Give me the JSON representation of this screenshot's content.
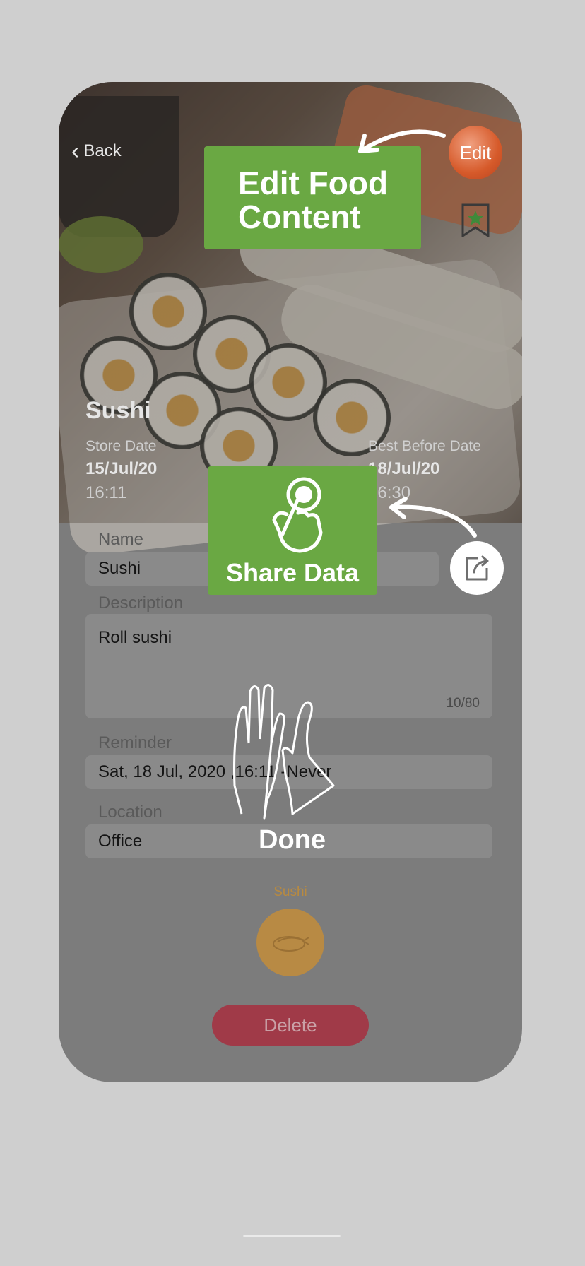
{
  "nav": {
    "back_label": "Back",
    "edit_label": "Edit"
  },
  "food": {
    "title": "Sushi",
    "store_date_label": "Store Date",
    "store_date": "15/Jul/20",
    "store_time": "16:11",
    "best_before_label": "Best Before Date",
    "best_before_date": "18/Jul/20",
    "best_before_time": "16:30"
  },
  "form": {
    "name_label": "Name",
    "name_value": "Sushi",
    "description_label": "Description",
    "description_value": "Roll sushi",
    "description_counter": "10/80",
    "reminder_label": "Reminder",
    "reminder_value": "Sat, 18  Jul, 2020 ,16:11 -Never",
    "location_label": "Location",
    "location_value": "Office"
  },
  "category": {
    "label": "Sushi",
    "icon": "sushi-icon"
  },
  "actions": {
    "delete_label": "Delete"
  },
  "tutorial": {
    "edit_tip": "Edit Food Content",
    "share_tip": "Share Data",
    "done_label": "Done"
  },
  "colors": {
    "tip_green": "#6aa843",
    "delete_red": "#a03a48",
    "category_gold": "#b88a44",
    "edit_orange": "#d65a2a"
  }
}
